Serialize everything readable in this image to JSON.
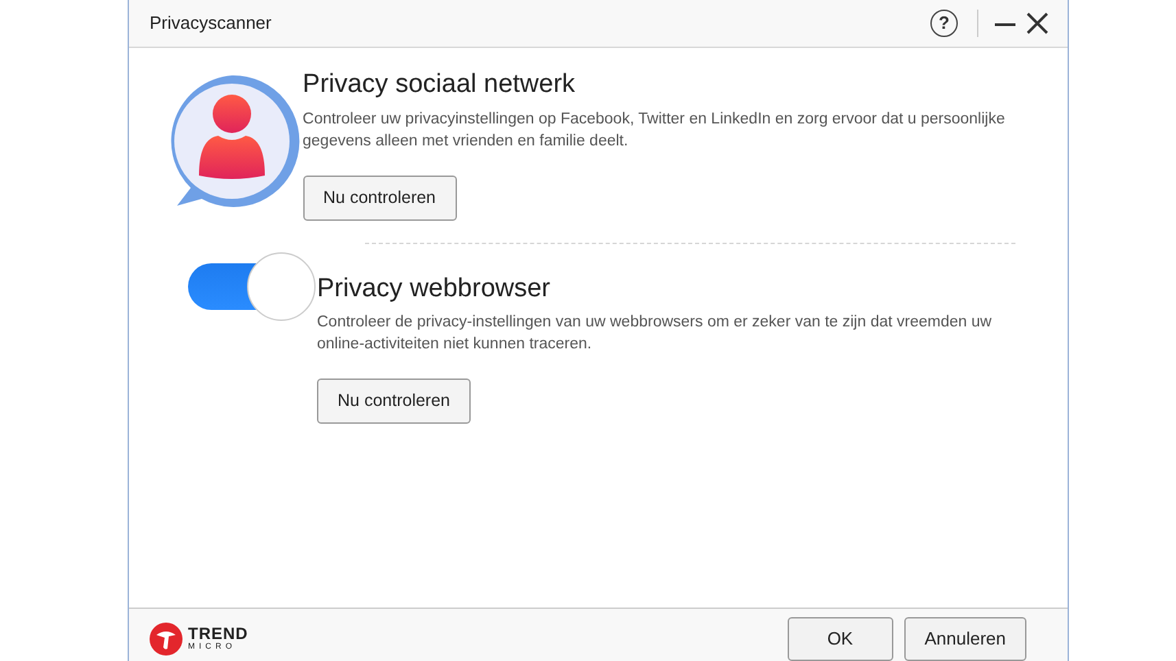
{
  "window": {
    "title": "Privacyscanner",
    "help": "?"
  },
  "sections": [
    {
      "kind": "avatar",
      "title": "Privacy sociaal netwerk",
      "description": "Controleer uw privacyinstellingen op Facebook, Twitter en LinkedIn en zorg ervoor dat u persoonlijke gegevens alleen met vrienden en familie deelt.",
      "button": "Nu controleren"
    },
    {
      "kind": "toggle",
      "on": true,
      "title": "Privacy webbrowser",
      "description": "Controleer de privacy-instellingen van uw webbrowsers om er zeker van te zijn dat vreemden uw online-activiteiten niet kunnen traceren.",
      "button": "Nu controleren"
    }
  ],
  "footer": {
    "logo_top": "TREND",
    "logo_bottom": "MICRO",
    "buttons": [
      "OK",
      "Annuleren"
    ]
  }
}
